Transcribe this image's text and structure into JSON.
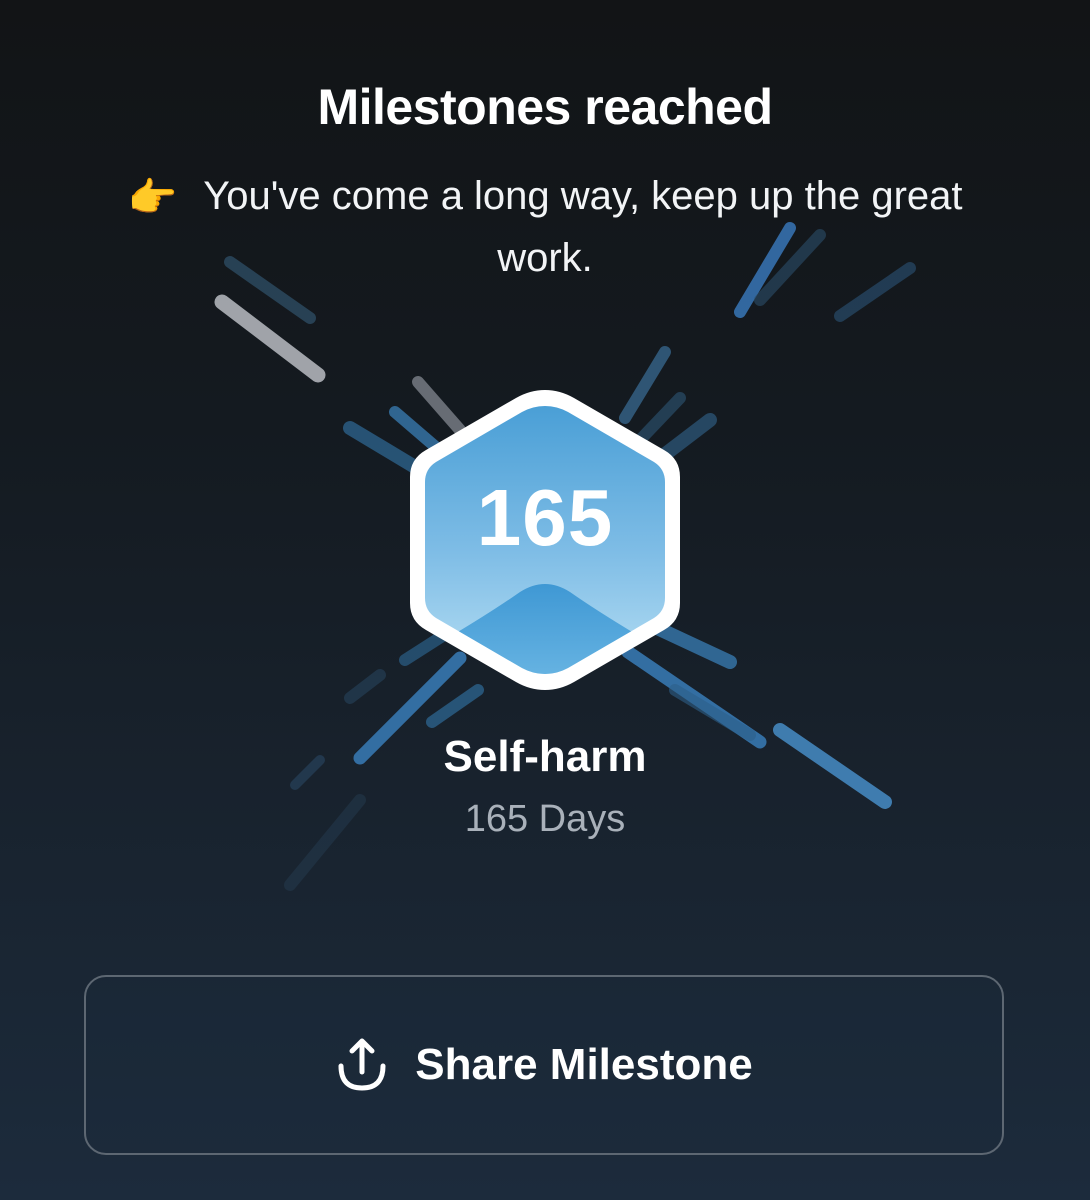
{
  "header": {
    "title": "Milestones reached",
    "message_emoji": "👉",
    "message": "You've come a long way, keep up the great work."
  },
  "milestone": {
    "badge_number": "165",
    "category": "Self-harm",
    "duration": "165 Days"
  },
  "actions": {
    "share_label": "Share Milestone",
    "share_icon": "share-upload-icon"
  },
  "colors": {
    "background_top": "#121416",
    "background_bottom": "#1c2b3c",
    "badge_blue": "#4aa0d8",
    "badge_light": "#a8d8f0",
    "badge_border": "#ffffff",
    "duration_gray": "#a9b1ba"
  }
}
